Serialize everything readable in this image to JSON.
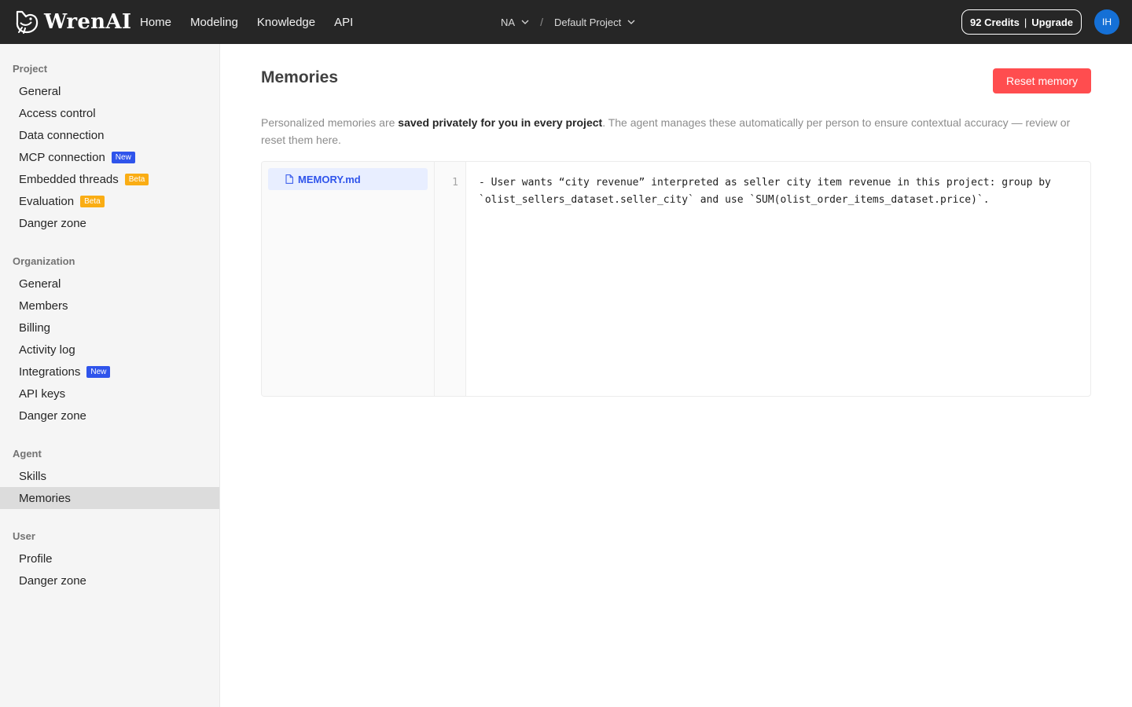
{
  "header": {
    "brand": "WrenAI",
    "nav": [
      {
        "label": "Home"
      },
      {
        "label": "Modeling"
      },
      {
        "label": "Knowledge"
      },
      {
        "label": "API"
      }
    ],
    "breadcrumb": {
      "workspace": "NA",
      "separator": "/",
      "project": "Default Project"
    },
    "credits": {
      "label": "92 Credits",
      "separator": "|",
      "upgrade": "Upgrade"
    },
    "avatar_initials": "IH"
  },
  "sidebar": {
    "project": {
      "title": "Project",
      "items": [
        {
          "label": "General"
        },
        {
          "label": "Access control"
        },
        {
          "label": "Data connection"
        },
        {
          "label": "MCP connection",
          "badge": "New"
        },
        {
          "label": "Embedded threads",
          "badge": "Beta"
        },
        {
          "label": "Evaluation",
          "badge": "Beta"
        },
        {
          "label": "Danger zone"
        }
      ]
    },
    "organization": {
      "title": "Organization",
      "items": [
        {
          "label": "General"
        },
        {
          "label": "Members"
        },
        {
          "label": "Billing"
        },
        {
          "label": "Activity log"
        },
        {
          "label": "Integrations",
          "badge": "New"
        },
        {
          "label": "API keys"
        },
        {
          "label": "Danger zone"
        }
      ]
    },
    "agent": {
      "title": "Agent",
      "items": [
        {
          "label": "Skills"
        },
        {
          "label": "Memories",
          "active": true
        }
      ]
    },
    "user": {
      "title": "User",
      "items": [
        {
          "label": "Profile"
        },
        {
          "label": "Danger zone"
        }
      ]
    }
  },
  "main": {
    "title": "Memories",
    "reset_label": "Reset memory",
    "description": {
      "part1": "Personalized memories are ",
      "bold": "saved privately for you in every project",
      "part2": ". The agent manages these automatically per person to ensure contextual accuracy — review or reset them here."
    },
    "file_name": "MEMORY.md",
    "line_number": "1",
    "content": "- User wants “city revenue” interpreted as seller city item revenue in this project: group by `olist_sellers_dataset.seller_city` and use `SUM(olist_order_items_dataset.price)`."
  },
  "colors": {
    "topbar": "#262626",
    "accent": "#2f54eb",
    "danger": "#ff4d4f",
    "beta": "#faad14",
    "avatar": "#1570d6"
  }
}
